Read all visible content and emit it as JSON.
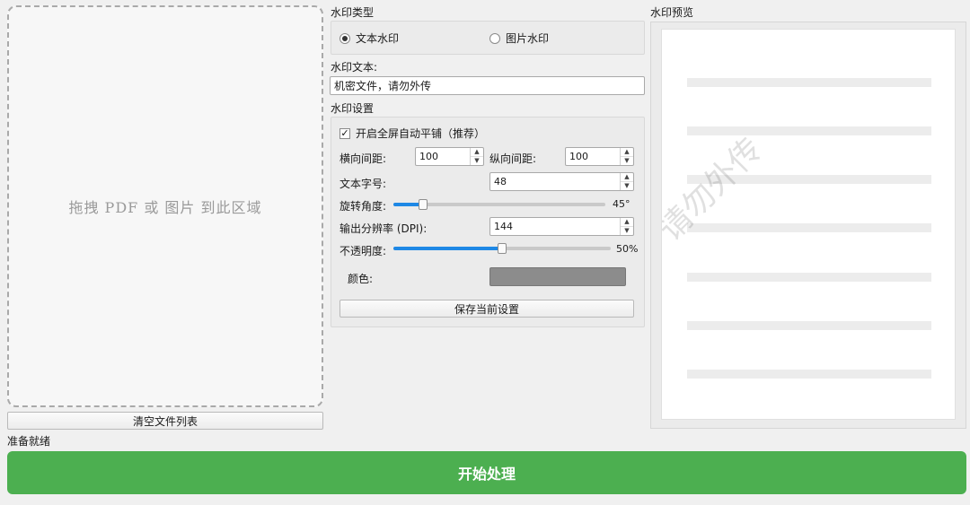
{
  "dropzone": {
    "hint": "拖拽 PDF 或 图片 到此区域"
  },
  "clear_button": "清空文件列表",
  "status": "准备就绪",
  "start_button": "开始处理",
  "watermark_type": {
    "section_label": "水印类型",
    "options": [
      {
        "label": "文本水印",
        "selected": true
      },
      {
        "label": "图片水印",
        "selected": false
      }
    ]
  },
  "watermark_text": {
    "label": "水印文本:",
    "value": "机密文件，请勿外传"
  },
  "settings": {
    "section_label": "水印设置",
    "tile_checkbox": {
      "label": "开启全屏自动平铺（推荐）",
      "checked": true
    },
    "h_spacing": {
      "label": "横向间距:",
      "value": "100"
    },
    "v_spacing": {
      "label": "纵向间距:",
      "value": "100"
    },
    "font_size": {
      "label": "文本字号:",
      "value": "48"
    },
    "rotation": {
      "label": "旋转角度:",
      "value": 45,
      "max": 360,
      "display": "45°"
    },
    "dpi": {
      "label": "输出分辨率 (DPI):",
      "value": "144"
    },
    "opacity": {
      "label": "不透明度:",
      "value": 50,
      "max": 100,
      "display": "50%"
    },
    "color": {
      "label": "颜色:",
      "value": "#8c8c8c"
    },
    "save_button": "保存当前设置"
  },
  "preview": {
    "label": "水印预览",
    "watermark": "请勿外传"
  },
  "colors": {
    "accent": "#4caf50",
    "slider": "#1e88e5",
    "background": "#f0f0f0"
  }
}
